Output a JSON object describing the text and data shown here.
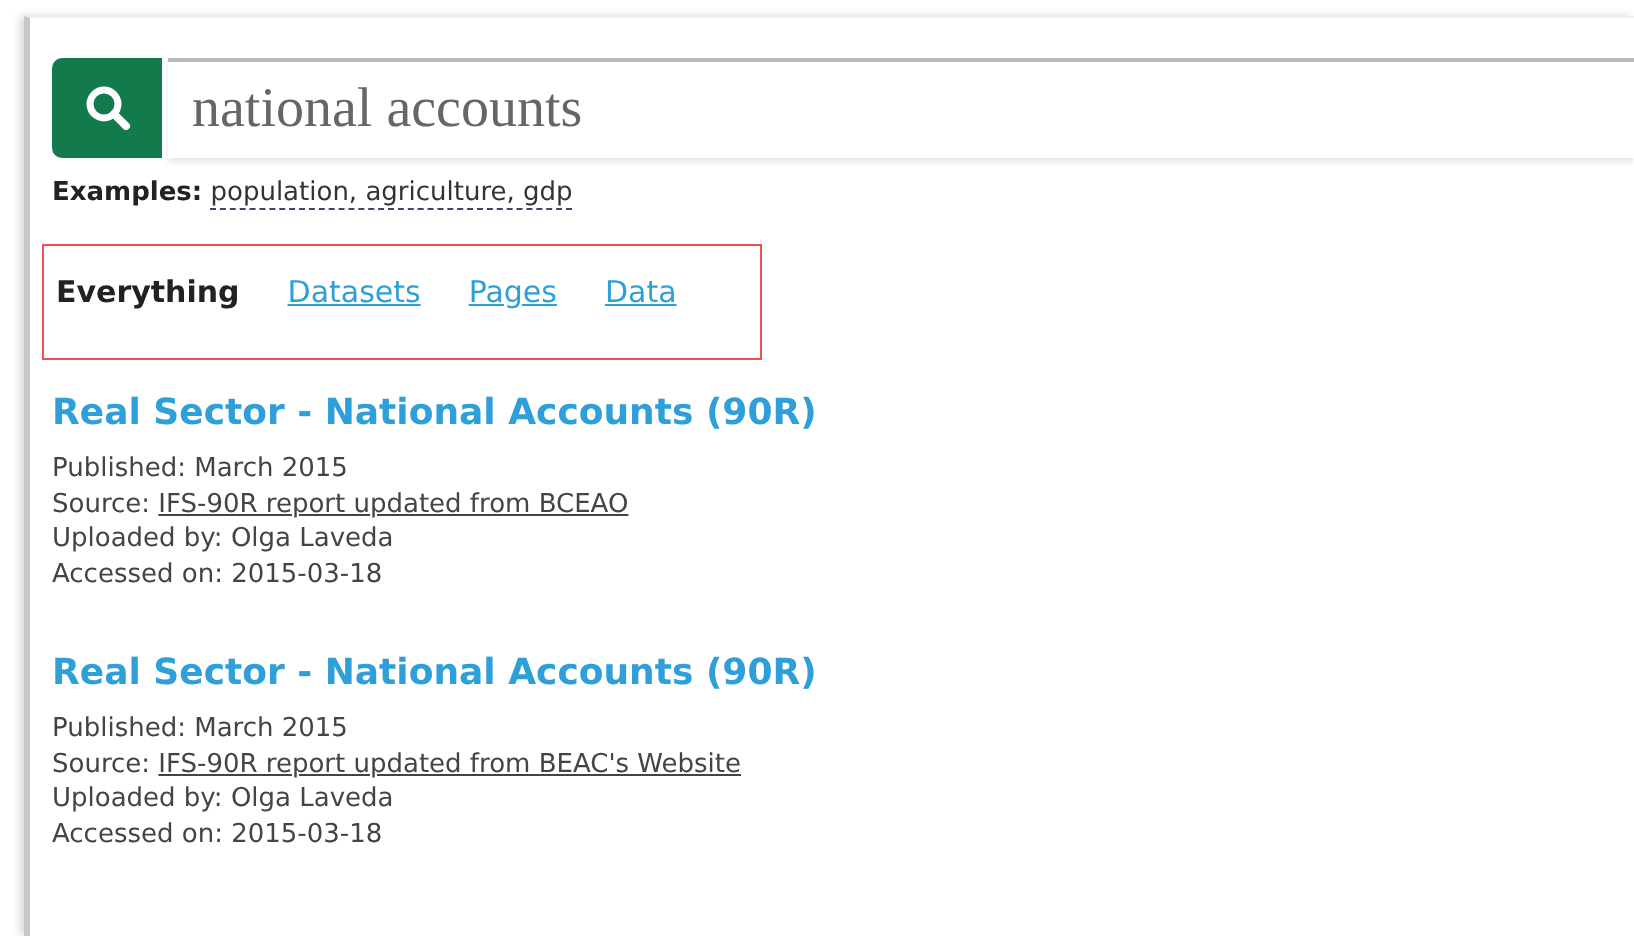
{
  "search": {
    "value": "national accounts"
  },
  "examples": {
    "label": "Examples:",
    "terms": "population, agriculture, gdp"
  },
  "tabs": [
    {
      "label": "Everything",
      "selected": true
    },
    {
      "label": "Datasets",
      "selected": false
    },
    {
      "label": "Pages",
      "selected": false
    },
    {
      "label": "Data",
      "selected": false
    }
  ],
  "results": [
    {
      "title": "Real Sector - National Accounts (90R)",
      "lines": [
        {
          "label": "Published:",
          "value": "March 2015",
          "link": false
        },
        {
          "label": "Source:",
          "value": "IFS-90R report updated from BCEAO",
          "link": true
        },
        {
          "label": "Uploaded by:",
          "value": "Olga Laveda",
          "link": false
        },
        {
          "label": "Accessed on:",
          "value": "2015-03-18",
          "link": false
        }
      ]
    },
    {
      "title": "Real Sector - National Accounts (90R)",
      "lines": [
        {
          "label": "Published:",
          "value": "March 2015",
          "link": false
        },
        {
          "label": "Source:",
          "value": "IFS-90R report updated from BEAC's Website",
          "link": true
        },
        {
          "label": "Uploaded by:",
          "value": "Olga Laveda",
          "link": false
        },
        {
          "label": "Accessed on:",
          "value": "2015-03-18",
          "link": false
        }
      ]
    }
  ]
}
